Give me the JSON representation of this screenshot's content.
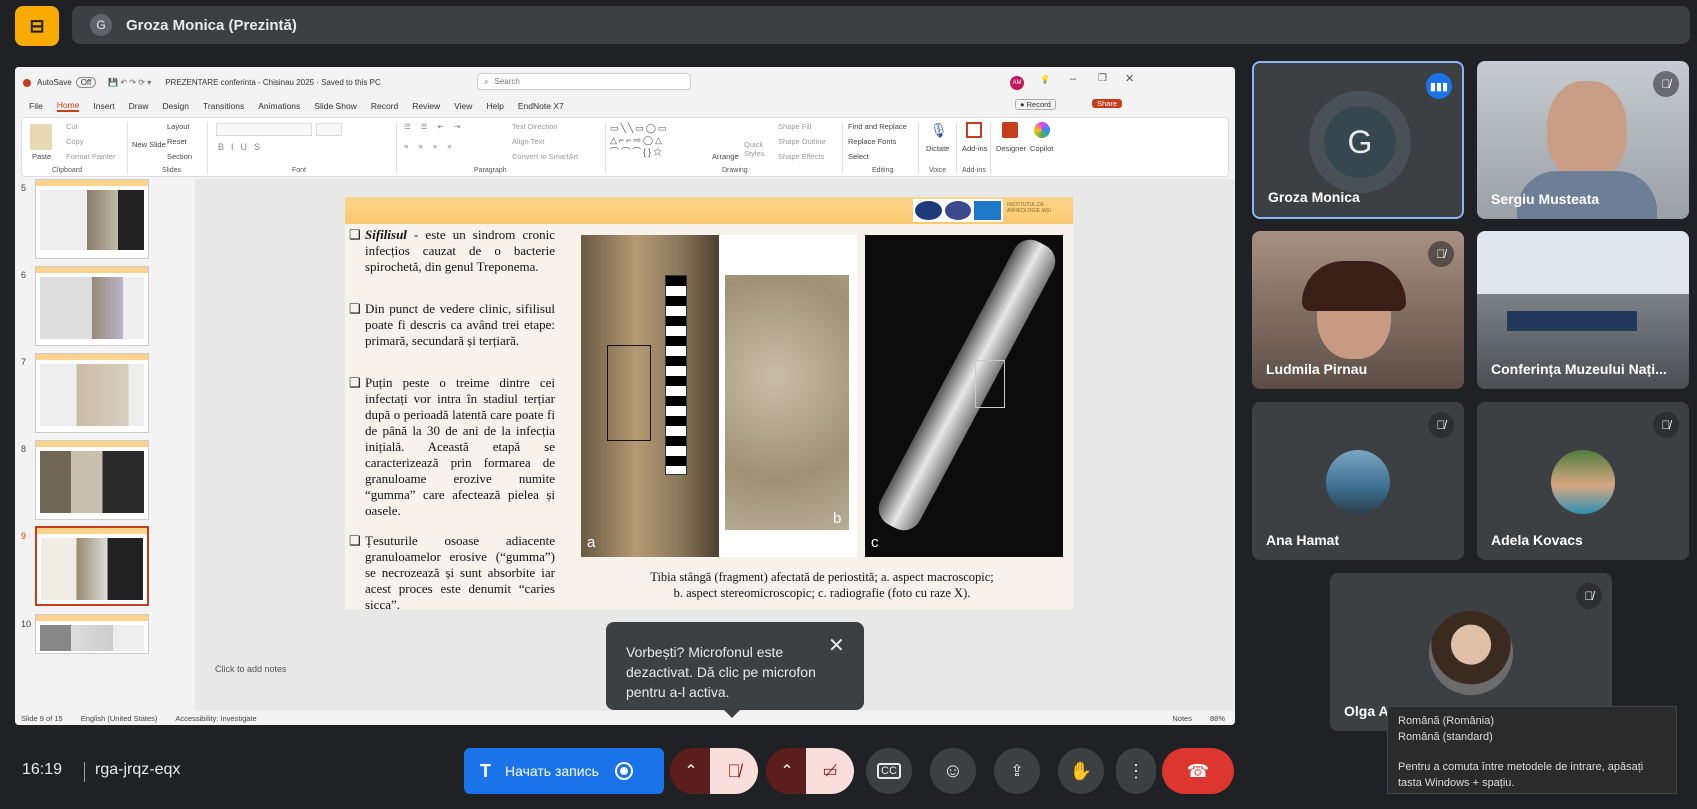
{
  "meet": {
    "presenter_bar": {
      "avatar_letter": "G",
      "title": "Groza Monica (Prezintă)"
    },
    "time": "16:19",
    "meeting_code": "rga-jrqz-eqx",
    "record_button": "Начать запись",
    "mic_tooltip": "Vorbești? Microfonul este dezactivat. Dă clic pe microfon pentru a-l activa.",
    "ime_popup": {
      "line1": "Română (România)",
      "line2": "Română (standard)",
      "line3": "Pentru a comuta între metodele de intrare, apăsați tasta Windows + spațiu."
    },
    "participants": [
      {
        "name": "Groza Monica",
        "initial": "G",
        "speaking": true
      },
      {
        "name": "Sergiu Musteata",
        "muted": true
      },
      {
        "name": "Ludmila Pirnau",
        "muted": true
      },
      {
        "name": "Conferința Muzeului Nați..."
      },
      {
        "name": "Ana Hamat",
        "muted": true
      },
      {
        "name": "Adela Kovacs",
        "muted": true
      },
      {
        "name": "Olga A",
        "muted": true
      }
    ]
  },
  "ppt": {
    "autosave": "AutoSave",
    "autosave_state": "Off",
    "doc_title": "PREZENTARE conferinta - Chisinau 2025 · Saved to this PC",
    "search_placeholder": "Search",
    "user_initials": "AM",
    "tabs": [
      "File",
      "Home",
      "Insert",
      "Draw",
      "Design",
      "Transitions",
      "Animations",
      "Slide Show",
      "Record",
      "Review",
      "View",
      "Help",
      "EndNote X7"
    ],
    "active_tab": "Home",
    "record_btn": "Record",
    "share_btn": "Share",
    "ribbon_groups": [
      "Clipboard",
      "Slides",
      "Font",
      "Paragraph",
      "Drawing",
      "Editing",
      "Voice",
      "Add-ins"
    ],
    "ribbon_items": {
      "paste": "Paste",
      "cut": "Cut",
      "copy": "Copy",
      "format_painter": "Format Painter",
      "new_slide": "New Slide",
      "layout": "Layout",
      "reset": "Reset",
      "section": "Section",
      "text_direction": "Text Direction",
      "align_text": "Align Text",
      "convert_smartart": "Convert to SmartArt",
      "arrange": "Arrange",
      "quick_styles": "Quick Styles",
      "shape_fill": "Shape Fill",
      "shape_outline": "Shape Outline",
      "shape_effects": "Shape Effects",
      "find_replace": "Find and Replace",
      "replace_fonts": "Replace Fonts",
      "select": "Select",
      "dictate": "Dictate",
      "addins": "Add-ins",
      "designer": "Designer",
      "copilot": "Copilot"
    },
    "slide_numbers": [
      "5",
      "6",
      "7",
      "8",
      "9",
      "10"
    ],
    "selected_slide": "9",
    "notes_placeholder": "Click to add notes",
    "status": {
      "slide": "Slide 9 of 15",
      "language": "English (United States)",
      "accessibility": "Accessibility: Investigate",
      "notes": "Notes",
      "zoom": "88%"
    }
  },
  "slide": {
    "logo_text": "INSTITUTUL DE ARHEOLOGIE IAȘI",
    "bullets": [
      {
        "lead": "Sifilisul",
        "text": " -  este un sindrom cronic infecțios cauzat de o bacterie spirochetă, din genul Treponema."
      },
      {
        "lead": "",
        "text": "Din punct de vedere clinic, sifilisul poate fi descris ca având trei etape: primară, secundară și terțiară."
      },
      {
        "lead": "",
        "text": "Puțin peste o treime dintre cei infectați vor intra în stadiul terțiar după o perioadă latentă care poate fi de până la 30 de ani de la infecția inițială. Această etapă se caracterizează prin formarea de granuloame erozive numite “gumma” care afectează pielea și oasele."
      },
      {
        "lead": "",
        "text": "Țesuturile osoase adiacente granuloamelor erosive (“gumma”) se necrozează și sunt absorbite iar acest proces este denumit “caries sicca”."
      }
    ],
    "panel_labels": [
      "a",
      "b",
      "c"
    ],
    "caption_line1": "Tibia stângă (fragment) afectată de periostită; a. aspect macroscopic;",
    "caption_line2": "b. aspect stereomicroscopic; c. radiografie (foto cu raze X)."
  }
}
